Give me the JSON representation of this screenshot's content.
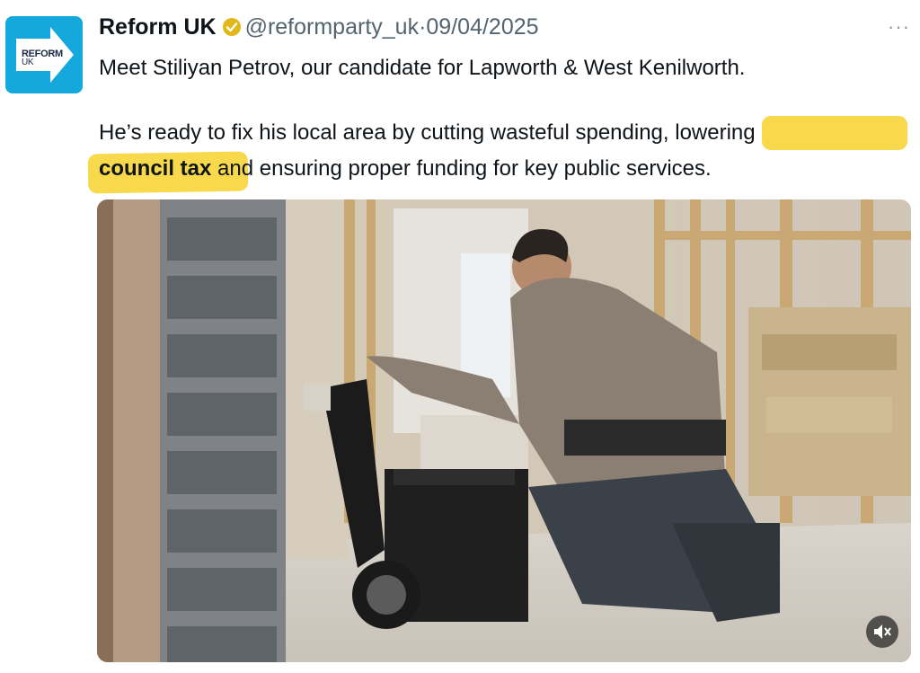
{
  "tweet": {
    "author_name": "Reform UK",
    "handle": "@reformparty_uk",
    "separator": "·",
    "date": "09/04/2025",
    "more_label": "···",
    "avatar_logo_line1": "REFORM",
    "avatar_logo_line2": "UK",
    "text_line1": "Meet Stiliyan Petrov, our candidate for Lapworth & West Kenilworth.",
    "text_line2_a": "He’s ready to fix his local area by cutting wasteful spending",
    "text_line2_b": ", lowering",
    "text_line3_a": "council tax",
    "text_line3_b": " and ensuring proper funding for key public services."
  },
  "colors": {
    "highlight": "#f7d22b",
    "avatar_bg": "#15a8dc",
    "verified_badge": "#e2b719",
    "meta_text": "#536471"
  },
  "icons": {
    "verified": "verified-badge-icon",
    "more": "more-options-icon",
    "mute": "speaker-muted-icon"
  }
}
